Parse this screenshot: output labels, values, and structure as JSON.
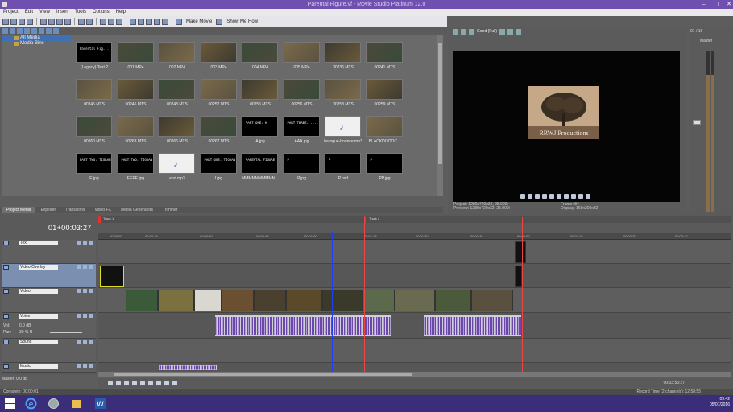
{
  "window": {
    "title": "Parental Figure.vf - Movie Studio Platinum 12.0",
    "controls": [
      "–",
      "▢",
      "✕"
    ]
  },
  "menu": [
    "Project",
    "Edit",
    "View",
    "Insert",
    "Tools",
    "Options",
    "Help"
  ],
  "toolbar": {
    "make_movie": "Make Movie",
    "show_me_how": "Show Me How"
  },
  "tree": {
    "items": [
      {
        "label": "All Media",
        "selected": true
      },
      {
        "label": "Media Bins",
        "selected": false
      }
    ]
  },
  "media": [
    {
      "label": "(Legacy) Text 2",
      "kind": "title",
      "text": "Parental Fig..."
    },
    {
      "label": "001.MP4",
      "kind": "video"
    },
    {
      "label": "002.MP4",
      "kind": "video"
    },
    {
      "label": "003.MP4",
      "kind": "video"
    },
    {
      "label": "004.MP4",
      "kind": "video"
    },
    {
      "label": "005.MP4",
      "kind": "video"
    },
    {
      "label": "00236.MTS",
      "kind": "video"
    },
    {
      "label": "00241.MTS",
      "kind": "video"
    },
    {
      "label": "00245.MTS",
      "kind": "video"
    },
    {
      "label": "00246.MTS",
      "kind": "video"
    },
    {
      "label": "00248.MTS",
      "kind": "video"
    },
    {
      "label": "00252.MTS",
      "kind": "video"
    },
    {
      "label": "00255.MTS",
      "kind": "video"
    },
    {
      "label": "00256.MTS",
      "kind": "video"
    },
    {
      "label": "00258.MTS",
      "kind": "video"
    },
    {
      "label": "00259.MTS",
      "kind": "video"
    },
    {
      "label": "00260.MTS",
      "kind": "video"
    },
    {
      "label": "00263.MTS",
      "kind": "video"
    },
    {
      "label": "00266.MTS",
      "kind": "video"
    },
    {
      "label": "00267.MTS",
      "kind": "video"
    },
    {
      "label": "A.jpg",
      "kind": "title",
      "text": "PART ONE: K"
    },
    {
      "label": "AAA.jpg",
      "kind": "title",
      "text": "PART THREE: ..."
    },
    {
      "label": "baroque-bounce.mp3",
      "kind": "audio"
    },
    {
      "label": "BLACKDOOOC...",
      "kind": "video"
    },
    {
      "label": "E.jpg",
      "kind": "title",
      "text": "PART TWO: TIGRAN"
    },
    {
      "label": "EEEE.jpg",
      "kind": "title",
      "text": "PART TWO: TIGRAN"
    },
    {
      "label": "end.mp3",
      "kind": "audio"
    },
    {
      "label": "I.jpg",
      "kind": "title",
      "text": "PART ONE: TIGRAN"
    },
    {
      "label": "MMMMMMMMMM...",
      "kind": "title",
      "text": "PARENTAL FIGURE"
    },
    {
      "label": "P.jpg",
      "kind": "title",
      "text": "P"
    },
    {
      "label": "P.psd",
      "kind": "title",
      "text": "P"
    },
    {
      "label": "PP.jpg",
      "kind": "title",
      "text": "P"
    }
  ],
  "tabs": [
    "Project Media",
    "Explorer",
    "Transitions",
    "Video FX",
    "Media Generators",
    "Trimmer"
  ],
  "preview": {
    "quality": "Good (Full)",
    "logo_text": "RRWJ Productions",
    "info_left": [
      "Project:  1280x720x32, 25.000i",
      "Preview:  1280x720x32, 25.000i"
    ],
    "info_right": [
      "Frame:  84",
      "Display:  169x309x32"
    ]
  },
  "master": {
    "title": "Master",
    "label_left": "01 / 16"
  },
  "timeline": {
    "timecode": "01+00:03:27",
    "tracks": [
      {
        "name": "Text",
        "selected": false
      },
      {
        "name": "Video Overlay",
        "selected": true
      },
      {
        "name": "Video",
        "selected": false
      },
      {
        "name": "Voice",
        "selected": false,
        "vol": "Vol:",
        "vol_val": "0.0 dB",
        "pan": "Pan:",
        "pan_val": "30 % R"
      },
      {
        "name": "Sound",
        "selected": false
      },
      {
        "name": "Music",
        "selected": false
      }
    ],
    "ruler": [
      "00:00:00",
      "00:00:15",
      "00:00:30",
      "00:00:45",
      "00:01:00",
      "00:01:15",
      "00:01:30",
      "00:01:45",
      "00:02:00",
      "00:02:15",
      "00:02:30",
      "00:02:42"
    ],
    "markers": [
      "Track 1",
      "Track 2"
    ],
    "master_bus": "Master: 0.0 dB",
    "end_time": "00:03:55:27"
  },
  "status": {
    "left": "Complete: 00:00:01",
    "right": "Record Time (2 channels): 12:58:55"
  },
  "clock": {
    "time": "09:42",
    "date": "05/07/2016"
  }
}
